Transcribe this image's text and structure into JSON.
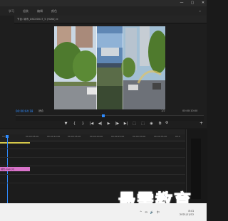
{
  "app": {
    "window_controls": [
      "—",
      "▢",
      "✕"
    ],
    "menu_tabs": [
      "学习",
      "组装",
      "编辑",
      "颜色"
    ],
    "more_tabs": "»"
  },
  "monitor": {
    "title": "节目: 城市_DSC00017_5 (H264) ≡",
    "timecode_left": "00:00:04:18",
    "fit_label": "适合",
    "fraction": "1/2",
    "timecode_right": "00:00:10:00"
  },
  "controls": {
    "marker": "▼",
    "in": "{",
    "out": "}",
    "go_in": "|◀",
    "step_back": "◀|",
    "play": "▶",
    "step_forward": "|▶",
    "go_out": "▶|",
    "lift": "⬚",
    "extract": "⬚",
    "export_frame": "◉",
    "compare": "⧉",
    "settings": "⚙",
    "add": "+"
  },
  "timeline": {
    "ticks": [
      "00:00",
      "00:00:05:00",
      "00:00:10:00",
      "00:00:15:00",
      "00:00:20:00",
      "00:00:25:00",
      "00:00:30:00",
      "00:00:35:00",
      "00:0"
    ],
    "clip_label": "城市.mp4 [V]"
  },
  "taskbar": {
    "time": "8:41",
    "date": "2021/11/12",
    "tray": [
      "^",
      "⊡",
      "🔊",
      "中"
    ]
  },
  "watermark": "最需教育",
  "colors": {
    "accent": "#2e8bff",
    "clip": "#d873c9",
    "watermark": "#1a2bd6"
  }
}
